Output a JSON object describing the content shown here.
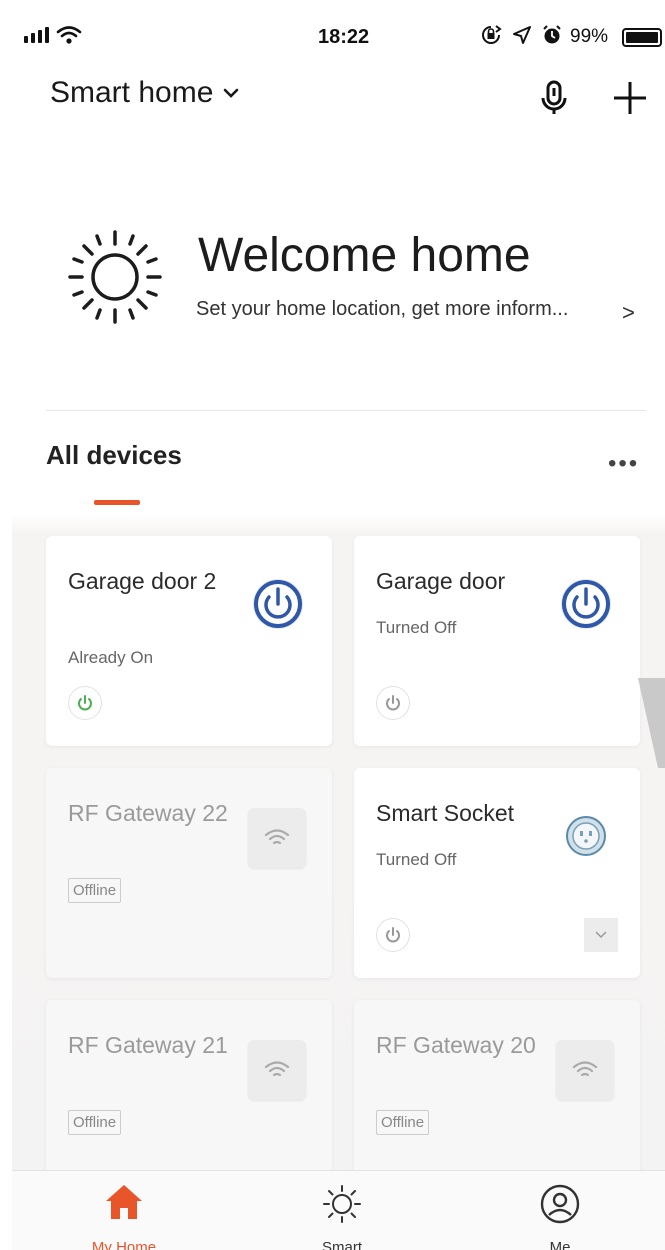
{
  "status_bar": {
    "time": "18:22",
    "battery": "99%",
    "icons": [
      "signal-icon",
      "wifi-icon",
      "rotation-lock-icon",
      "location-icon",
      "alarm-icon",
      "battery-icon"
    ]
  },
  "header": {
    "title": "Smart home",
    "icons": [
      "chevron-down-icon",
      "microphone-icon",
      "plus-icon"
    ]
  },
  "welcome": {
    "title": "Welcome home",
    "subtitle": "Set your home location, get more inform...",
    "chevron": ">",
    "icon": "sun-icon"
  },
  "devices": {
    "section_title": "All devices",
    "more": "•••",
    "items": [
      {
        "name": "Garage door 2",
        "status": "Already On",
        "power_state": "on",
        "icon": "power-icon"
      },
      {
        "name": "Garage door",
        "status": "Turned Off",
        "power_state": "off",
        "icon": "power-icon"
      },
      {
        "name": "RF Gateway 22",
        "badge": "Offline",
        "icon": "wifi-icon"
      },
      {
        "name": "Smart Socket",
        "status": "Turned Off",
        "power_state": "off",
        "icon": "socket-icon"
      },
      {
        "name": "RF Gateway 21",
        "badge": "Offline",
        "icon": "wifi-icon"
      },
      {
        "name": "RF Gateway 20",
        "badge": "Offline",
        "icon": "wifi-icon"
      }
    ]
  },
  "bottom_nav": {
    "items": [
      {
        "label": "My Home",
        "icon": "home-icon",
        "active": true
      },
      {
        "label": "Smart",
        "icon": "sun-icon",
        "active": false
      },
      {
        "label": "Me",
        "icon": "user-icon",
        "active": false
      }
    ]
  },
  "colors": {
    "accent": "#e8552a",
    "power_on": "#4caf50",
    "device_blue": "#2f59a8"
  }
}
